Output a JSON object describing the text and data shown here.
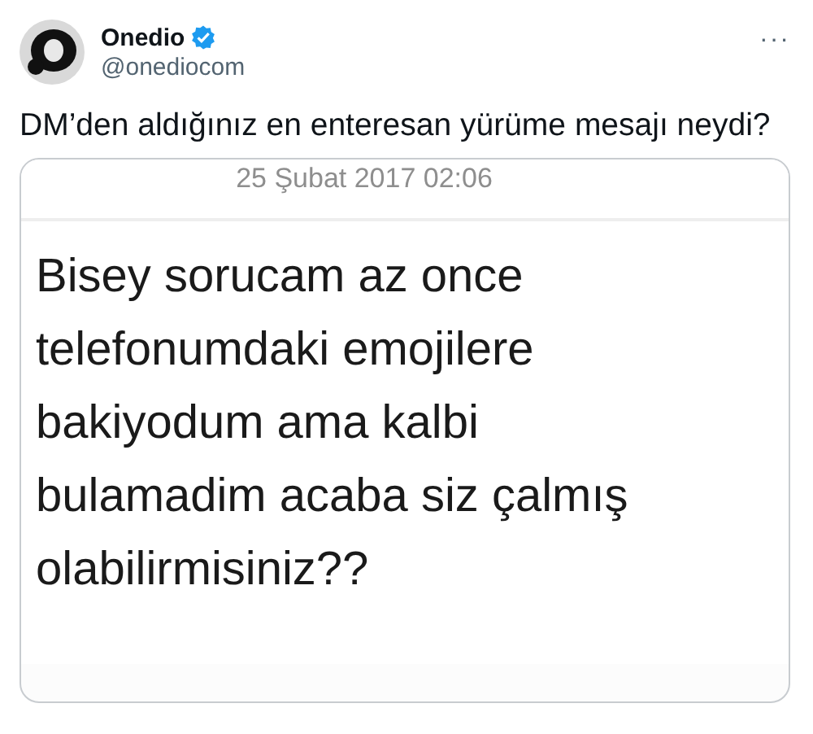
{
  "author": {
    "name": "Onedio",
    "handle": "@onediocom",
    "more": "···"
  },
  "tweet_text": "DM’den aldığınız en enteresan yürüme mesajı neydi?",
  "attachment": {
    "date": "25 Şubat 2017 02:06",
    "message_lines": [
      "Bisey sorucam az once",
      "telefonumdaki emojilere",
      "bakiyodum ama kalbi",
      "bulamadim acaba siz çalmış",
      "olabilirmisiniz??"
    ]
  }
}
